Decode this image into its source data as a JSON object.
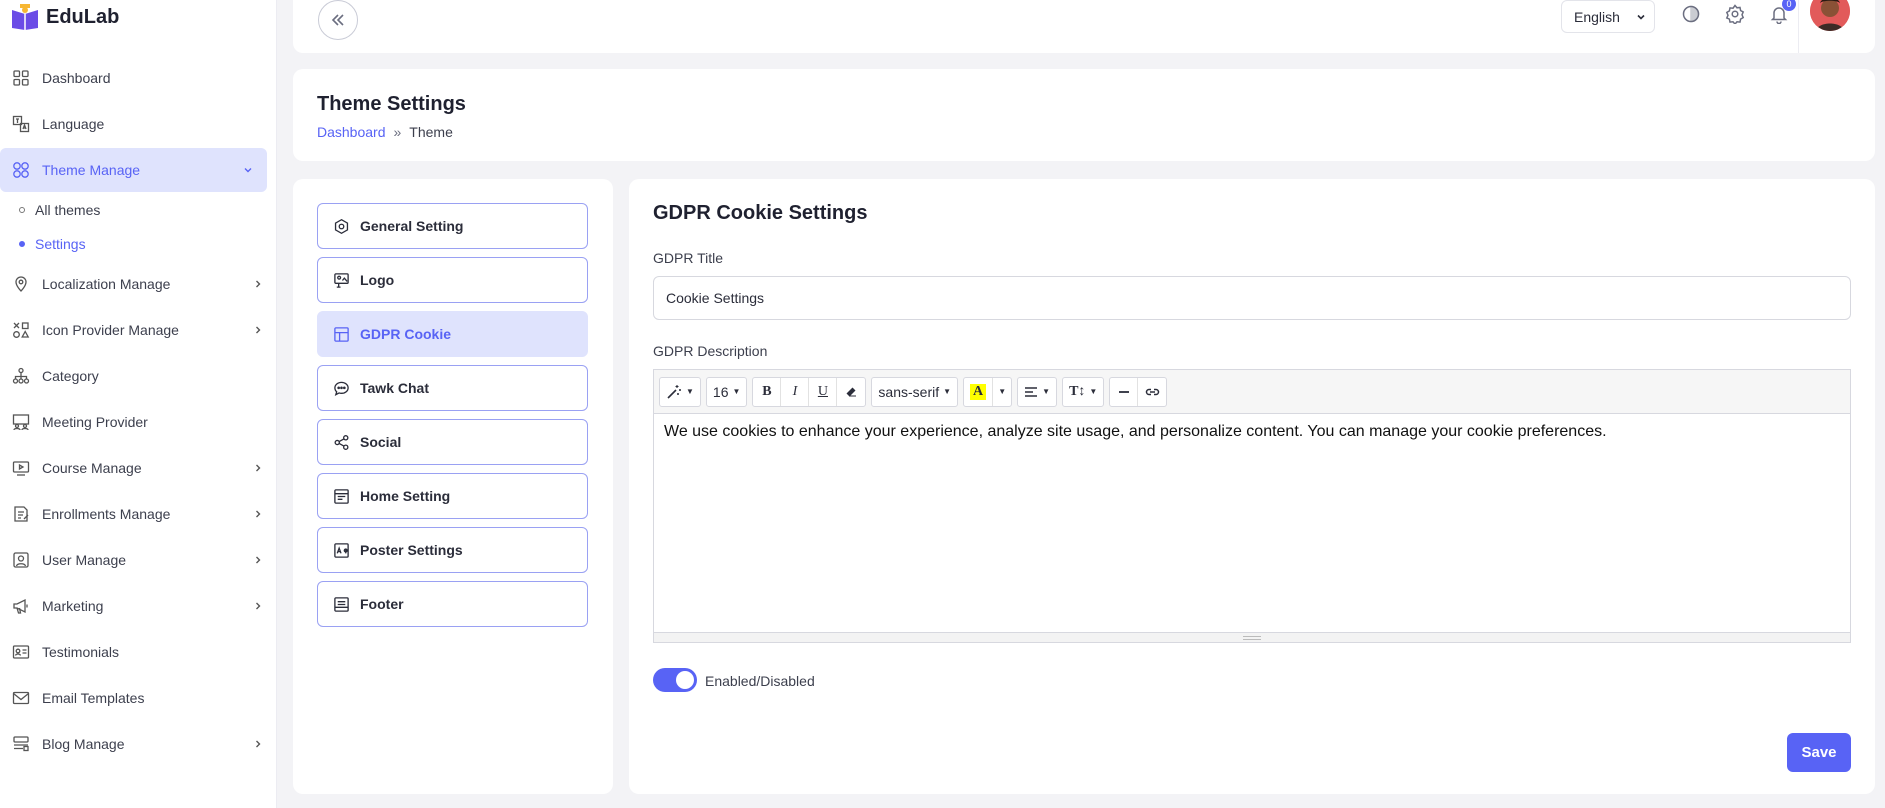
{
  "brand": {
    "name": "EduLab"
  },
  "sidebar": {
    "items": [
      {
        "label": "Dashboard",
        "icon": "grid-icon"
      },
      {
        "label": "Language",
        "icon": "translate-icon"
      },
      {
        "label": "Theme Manage",
        "icon": "theme-icon",
        "active": true
      },
      {
        "label": "Localization Manage",
        "icon": "location-icon"
      },
      {
        "label": "Icon Provider Manage",
        "icon": "shapes-icon"
      },
      {
        "label": "Category",
        "icon": "hierarchy-icon"
      },
      {
        "label": "Meeting Provider",
        "icon": "meeting-icon"
      },
      {
        "label": "Course Manage",
        "icon": "video-icon"
      },
      {
        "label": "Enrollments Manage",
        "icon": "enroll-icon"
      },
      {
        "label": "User Manage",
        "icon": "user-icon"
      },
      {
        "label": "Marketing",
        "icon": "megaphone-icon"
      },
      {
        "label": "Testimonials",
        "icon": "id-card-icon"
      },
      {
        "label": "Email Templates",
        "icon": "mail-icon"
      },
      {
        "label": "Blog Manage",
        "icon": "blog-icon"
      }
    ],
    "theme_sub": [
      {
        "label": "All themes"
      },
      {
        "label": "Settings",
        "active": true
      }
    ]
  },
  "topbar": {
    "language": "English",
    "notification_count": "0"
  },
  "page": {
    "title": "Theme Settings",
    "breadcrumb": {
      "home": "Dashboard",
      "separator": "»",
      "current": "Theme"
    }
  },
  "settings_menu": [
    {
      "label": "General Setting",
      "icon": "gear-hex-icon"
    },
    {
      "label": "Logo",
      "icon": "logo-icon"
    },
    {
      "label": "GDPR Cookie",
      "icon": "cookie-icon",
      "active": true
    },
    {
      "label": "Tawk Chat",
      "icon": "chat-icon"
    },
    {
      "label": "Social",
      "icon": "share-icon"
    },
    {
      "label": "Home Setting",
      "icon": "layout-icon"
    },
    {
      "label": "Poster Settings",
      "icon": "poster-icon"
    },
    {
      "label": "Footer",
      "icon": "footer-icon"
    }
  ],
  "form": {
    "title": "GDPR Cookie Settings",
    "gdpr_title_label": "GDPR Title",
    "gdpr_title_value": "Cookie Settings",
    "gdpr_desc_label": "GDPR Description",
    "editor": {
      "font_size": "16",
      "font_family": "sans-serif",
      "content": "We use cookies to enhance your experience, analyze site usage, and personalize content. You can manage your cookie preferences."
    },
    "toggle_label": "Enabled/Disabled",
    "toggle_on": true,
    "save_label": "Save"
  },
  "colors": {
    "accent": "#5863f5",
    "accent_soft": "#dfe3fd",
    "avatar": "#e25a5a"
  }
}
